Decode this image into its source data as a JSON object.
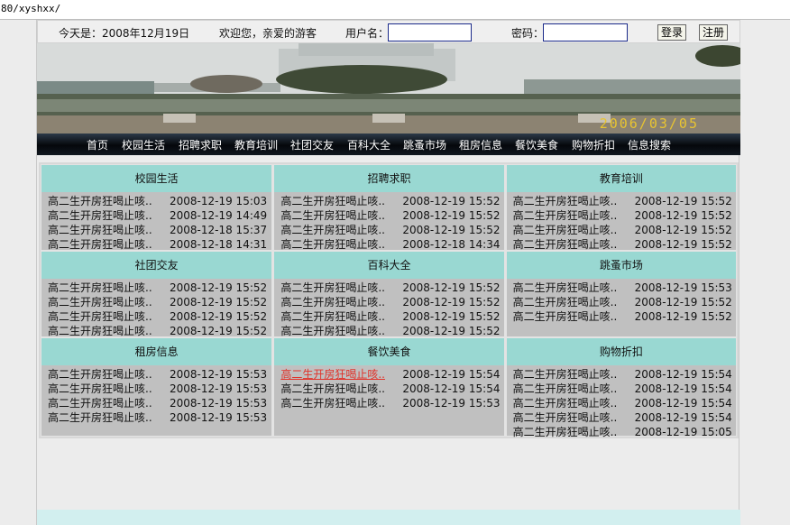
{
  "browser": {
    "url": "80/xyshxx/"
  },
  "topbar": {
    "date": "今天是：2008年12月19日",
    "welcome": "欢迎您，亲爱的游客",
    "username_label": "用户名：",
    "username_value": "",
    "password_label": "密码：",
    "password_value": "",
    "login_label": "登录",
    "register_label": "注册"
  },
  "banner": {
    "stamp": "2006/03/05"
  },
  "nav": [
    "首页",
    "校园生活",
    "招聘求职",
    "教育培训",
    "社团交友",
    "百科大全",
    "跳蚤市场",
    "租房信息",
    "餐饮美食",
    "购物折扣",
    "信息搜索"
  ],
  "sections": [
    {
      "title": "校园生活",
      "items": [
        {
          "title": "高二生开房狂喝止咳..",
          "date": "2008-12-19 15:03"
        },
        {
          "title": "高二生开房狂喝止咳..",
          "date": "2008-12-19 14:49"
        },
        {
          "title": "高二生开房狂喝止咳..",
          "date": "2008-12-18 15:37"
        },
        {
          "title": "高二生开房狂喝止咳..",
          "date": "2008-12-18 14:31"
        }
      ]
    },
    {
      "title": "招聘求职",
      "items": [
        {
          "title": "高二生开房狂喝止咳..",
          "date": "2008-12-19 15:52"
        },
        {
          "title": "高二生开房狂喝止咳..",
          "date": "2008-12-19 15:52"
        },
        {
          "title": "高二生开房狂喝止咳..",
          "date": "2008-12-19 15:52"
        },
        {
          "title": "高二生开房狂喝止咳..",
          "date": "2008-12-18 14:34"
        }
      ]
    },
    {
      "title": "教育培训",
      "items": [
        {
          "title": "高二生开房狂喝止咳..",
          "date": "2008-12-19 15:52"
        },
        {
          "title": "高二生开房狂喝止咳..",
          "date": "2008-12-19 15:52"
        },
        {
          "title": "高二生开房狂喝止咳..",
          "date": "2008-12-19 15:52"
        },
        {
          "title": "高二生开房狂喝止咳..",
          "date": "2008-12-19 15:52"
        }
      ]
    },
    {
      "title": "社团交友",
      "items": [
        {
          "title": "高二生开房狂喝止咳..",
          "date": "2008-12-19 15:52"
        },
        {
          "title": "高二生开房狂喝止咳..",
          "date": "2008-12-19 15:52"
        },
        {
          "title": "高二生开房狂喝止咳..",
          "date": "2008-12-19 15:52"
        },
        {
          "title": "高二生开房狂喝止咳..",
          "date": "2008-12-19 15:52"
        }
      ]
    },
    {
      "title": "百科大全",
      "items": [
        {
          "title": "高二生开房狂喝止咳..",
          "date": "2008-12-19 15:52"
        },
        {
          "title": "高二生开房狂喝止咳..",
          "date": "2008-12-19 15:52"
        },
        {
          "title": "高二生开房狂喝止咳..",
          "date": "2008-12-19 15:52"
        },
        {
          "title": "高二生开房狂喝止咳..",
          "date": "2008-12-19 15:52"
        }
      ]
    },
    {
      "title": "跳蚤市场",
      "items": [
        {
          "title": "高二生开房狂喝止咳..",
          "date": "2008-12-19 15:53"
        },
        {
          "title": "高二生开房狂喝止咳..",
          "date": "2008-12-19 15:52"
        },
        {
          "title": "高二生开房狂喝止咳..",
          "date": "2008-12-19 15:52"
        }
      ]
    },
    {
      "title": "租房信息",
      "items": [
        {
          "title": "高二生开房狂喝止咳..",
          "date": "2008-12-19 15:53"
        },
        {
          "title": "高二生开房狂喝止咳..",
          "date": "2008-12-19 15:53"
        },
        {
          "title": "高二生开房狂喝止咳..",
          "date": "2008-12-19 15:53"
        },
        {
          "title": "高二生开房狂喝止咳..",
          "date": "2008-12-19 15:53"
        }
      ]
    },
    {
      "title": "餐饮美食",
      "items": [
        {
          "title": "高二生开房狂喝止咳..",
          "date": "2008-12-19 15:54",
          "active": true
        },
        {
          "title": "高二生开房狂喝止咳..",
          "date": "2008-12-19 15:54"
        },
        {
          "title": "高二生开房狂喝止咳..",
          "date": "2008-12-19 15:53"
        }
      ]
    },
    {
      "title": "购物折扣",
      "items": [
        {
          "title": "高二生开房狂喝止咳..",
          "date": "2008-12-19 15:54"
        },
        {
          "title": "高二生开房狂喝止咳..",
          "date": "2008-12-19 15:54"
        },
        {
          "title": "高二生开房狂喝止咳..",
          "date": "2008-12-19 15:54"
        },
        {
          "title": "高二生开房狂喝止咳..",
          "date": "2008-12-19 15:54"
        },
        {
          "title": "高二生开房狂喝止咳..",
          "date": "2008-12-19 15:05"
        }
      ]
    }
  ],
  "colors": {
    "section_header": "#99d8d2",
    "section_body": "#c0c0c0",
    "nav_bg": "#05070b",
    "link_active": "#e0332b"
  }
}
